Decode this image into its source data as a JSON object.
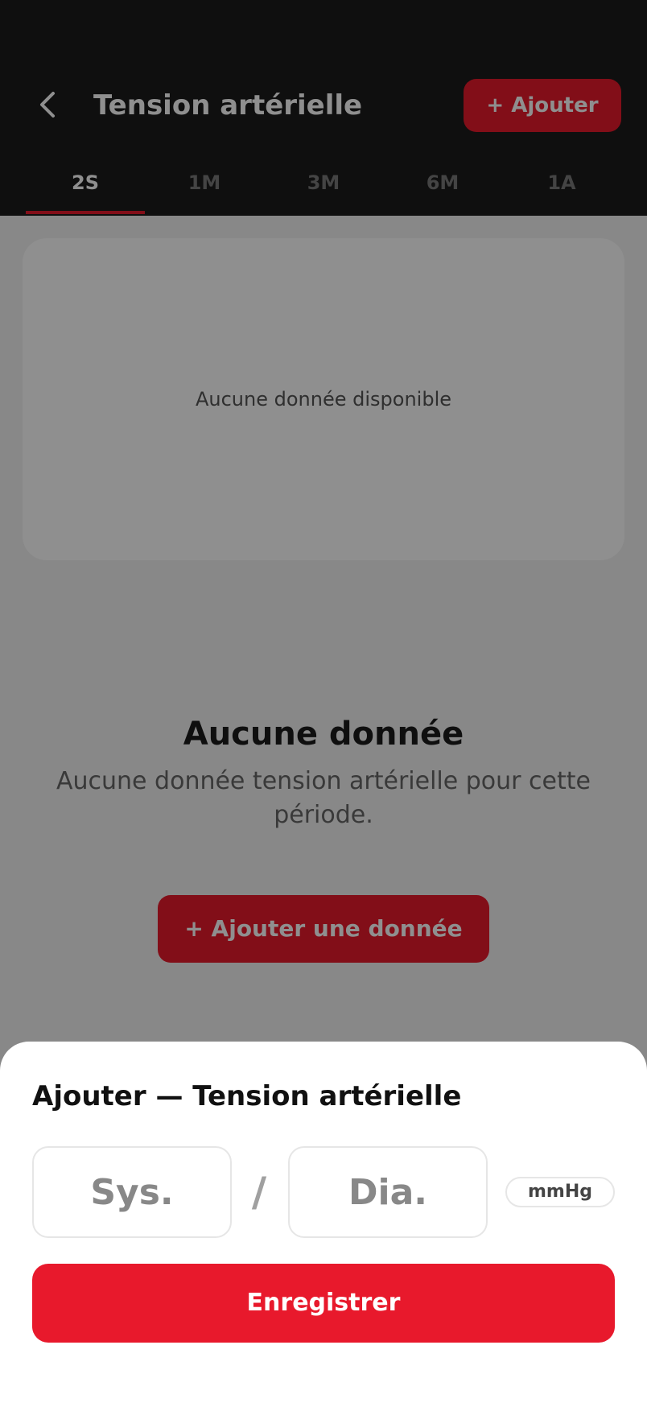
{
  "header": {
    "title": "Tension artérielle",
    "add_label": "+ Ajouter",
    "back_icon": "chevron-left-icon"
  },
  "tabs": [
    {
      "label": "2S",
      "active": true
    },
    {
      "label": "1M",
      "active": false
    },
    {
      "label": "3M",
      "active": false
    },
    {
      "label": "6M",
      "active": false
    },
    {
      "label": "1A",
      "active": false
    }
  ],
  "chart": {
    "empty_text": "Aucune donnée disponible"
  },
  "empty_state": {
    "title": "Aucune donnée",
    "description": "Aucune donnée tension artérielle pour cette période.",
    "cta_label": "+ Ajouter une donnée"
  },
  "sheet": {
    "title": "Ajouter — Tension artérielle",
    "systolic_placeholder": "Sys.",
    "systolic_value": "",
    "separator": "/",
    "diastolic_placeholder": "Dia.",
    "diastolic_value": "",
    "unit": "mmHg",
    "save_label": "Enregistrer"
  },
  "colors": {
    "accent": "#e8192c",
    "header_bg": "#1c1c1c",
    "page_bg": "#f3f3f3"
  }
}
